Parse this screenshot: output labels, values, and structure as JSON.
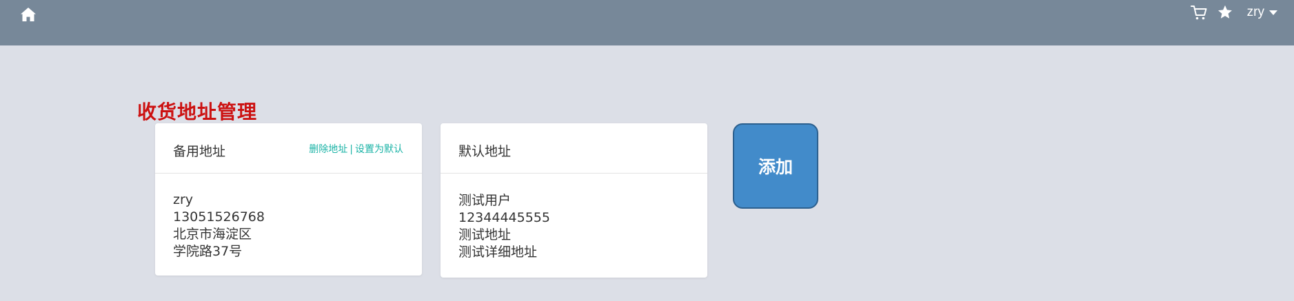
{
  "header": {
    "username": "zry"
  },
  "page": {
    "title": "收货地址管理"
  },
  "addresses": [
    {
      "heading": "备用地址",
      "actions": {
        "delete": "删除地址",
        "separator": "|",
        "set_default": "设置为默认"
      },
      "name": "zry",
      "phone": "13051526768",
      "region": "北京市海淀区",
      "detail": "学院路37号"
    },
    {
      "heading": "默认地址",
      "name": "测试用户",
      "phone": "12344445555",
      "region": "测试地址",
      "detail": "测试详细地址"
    }
  ],
  "add_button": {
    "label": "添加"
  },
  "icons": {
    "home": "home-icon",
    "cart": "cart-icon",
    "favorites": "star-icon",
    "dropdown": "caret-down-icon"
  },
  "colors": {
    "header_bg": "#778899",
    "page_bg": "#dcdfe7",
    "title": "#cc1111",
    "link": "#1ab3a6",
    "add_button": "#428bca"
  }
}
